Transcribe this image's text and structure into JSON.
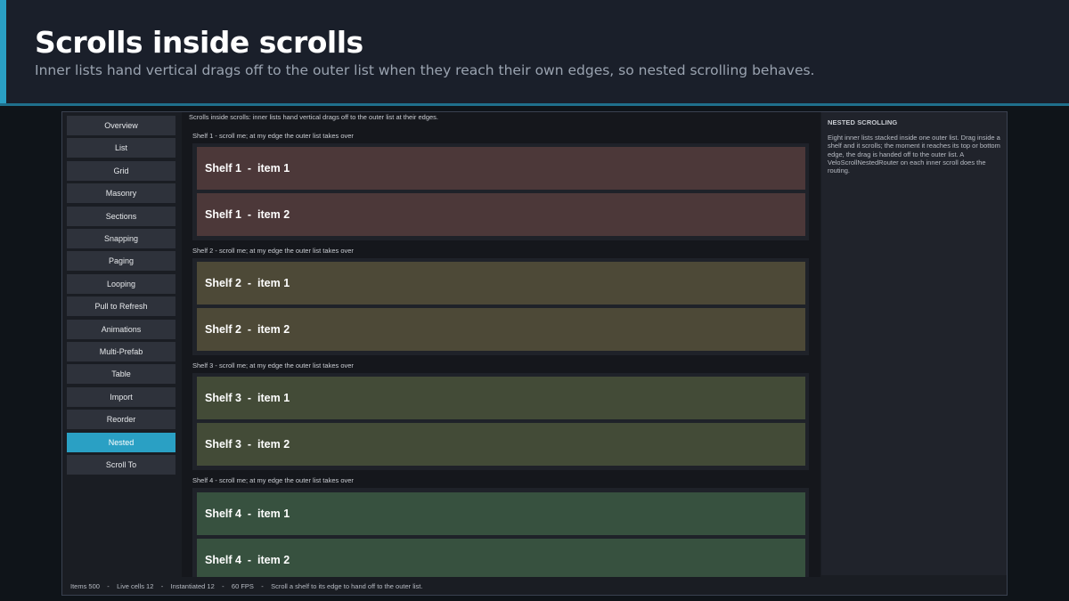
{
  "hero": {
    "title": "Scrolls inside scrolls",
    "subtitle": "Inner lists hand vertical drags off to the outer list when they reach their own edges, so nested scrolling behaves."
  },
  "nav": {
    "items": [
      "Overview",
      "List",
      "Grid",
      "Masonry",
      "Sections",
      "Snapping",
      "Paging",
      "Looping",
      "Pull to Refresh",
      "Animations",
      "Multi-Prefab",
      "Table",
      "Import",
      "Reorder",
      "Nested",
      "Scroll To"
    ],
    "active": "Nested"
  },
  "main": {
    "caption": "Scrolls inside scrolls: inner lists hand vertical drags off to the outer list at their edges.",
    "shelves": [
      {
        "label": "Shelf 1  -  scroll me; at my edge the outer list takes over",
        "color": "#4c3839",
        "items": [
          "Shelf 1  -  item 1",
          "Shelf 1  -  item 2"
        ]
      },
      {
        "label": "Shelf 2  -  scroll me; at my edge the outer list takes over",
        "color": "#4d4937",
        "items": [
          "Shelf 2  -  item 1",
          "Shelf 2  -  item 2"
        ]
      },
      {
        "label": "Shelf 3  -  scroll me; at my edge the outer list takes over",
        "color": "#434b37",
        "items": [
          "Shelf 3  -  item 1",
          "Shelf 3  -  item 2"
        ]
      },
      {
        "label": "Shelf 4  -  scroll me; at my edge the outer list takes over",
        "color": "#37513f",
        "items": [
          "Shelf 4  -  item 1",
          "Shelf 4  -  item 2"
        ]
      }
    ]
  },
  "side_panel": {
    "title": "NESTED SCROLLING",
    "body": "Eight inner lists stacked inside one outer list. Drag inside a shelf and it scrolls; the moment it reaches its top or bottom edge, the drag is handed off to the outer list. A VeloScrollNestedRouter on each inner scroll does the routing."
  },
  "status": {
    "text": "Items 500    -    Live cells 12    -    Instantiated 12    -    60 FPS    -    Scroll a shelf to its edge to hand off to the outer list."
  },
  "colors": {
    "accent": "#2aa0c4",
    "background": "#0f1419"
  }
}
